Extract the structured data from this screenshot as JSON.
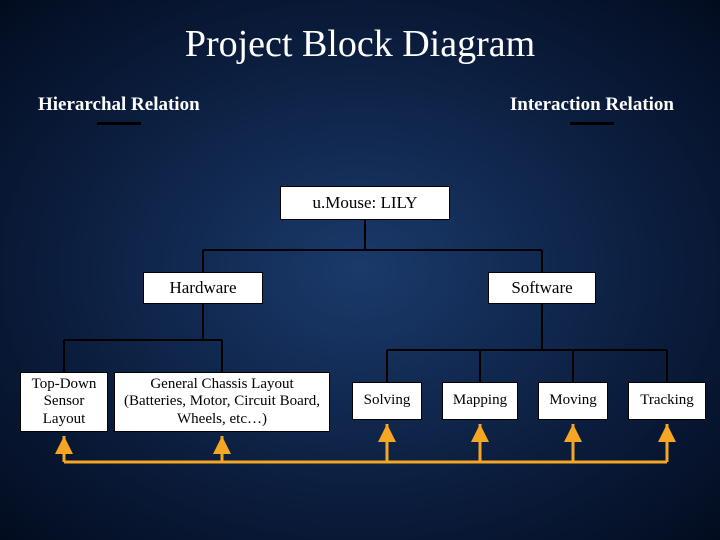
{
  "title": "Project Block Diagram",
  "legend": {
    "left": "Hierarchal  Relation",
    "right": "Interaction Relation"
  },
  "nodes": {
    "root": "u.Mouse: LILY",
    "hardware": "Hardware",
    "software": "Software",
    "topdown": "Top-Down Sensor Layout",
    "chassis": "General Chassis Layout (Batteries, Motor, Circuit Board, Wheels, etc…)",
    "solving": "Solving",
    "mapping": "Mapping",
    "moving": "Moving",
    "tracking": "Tracking"
  }
}
